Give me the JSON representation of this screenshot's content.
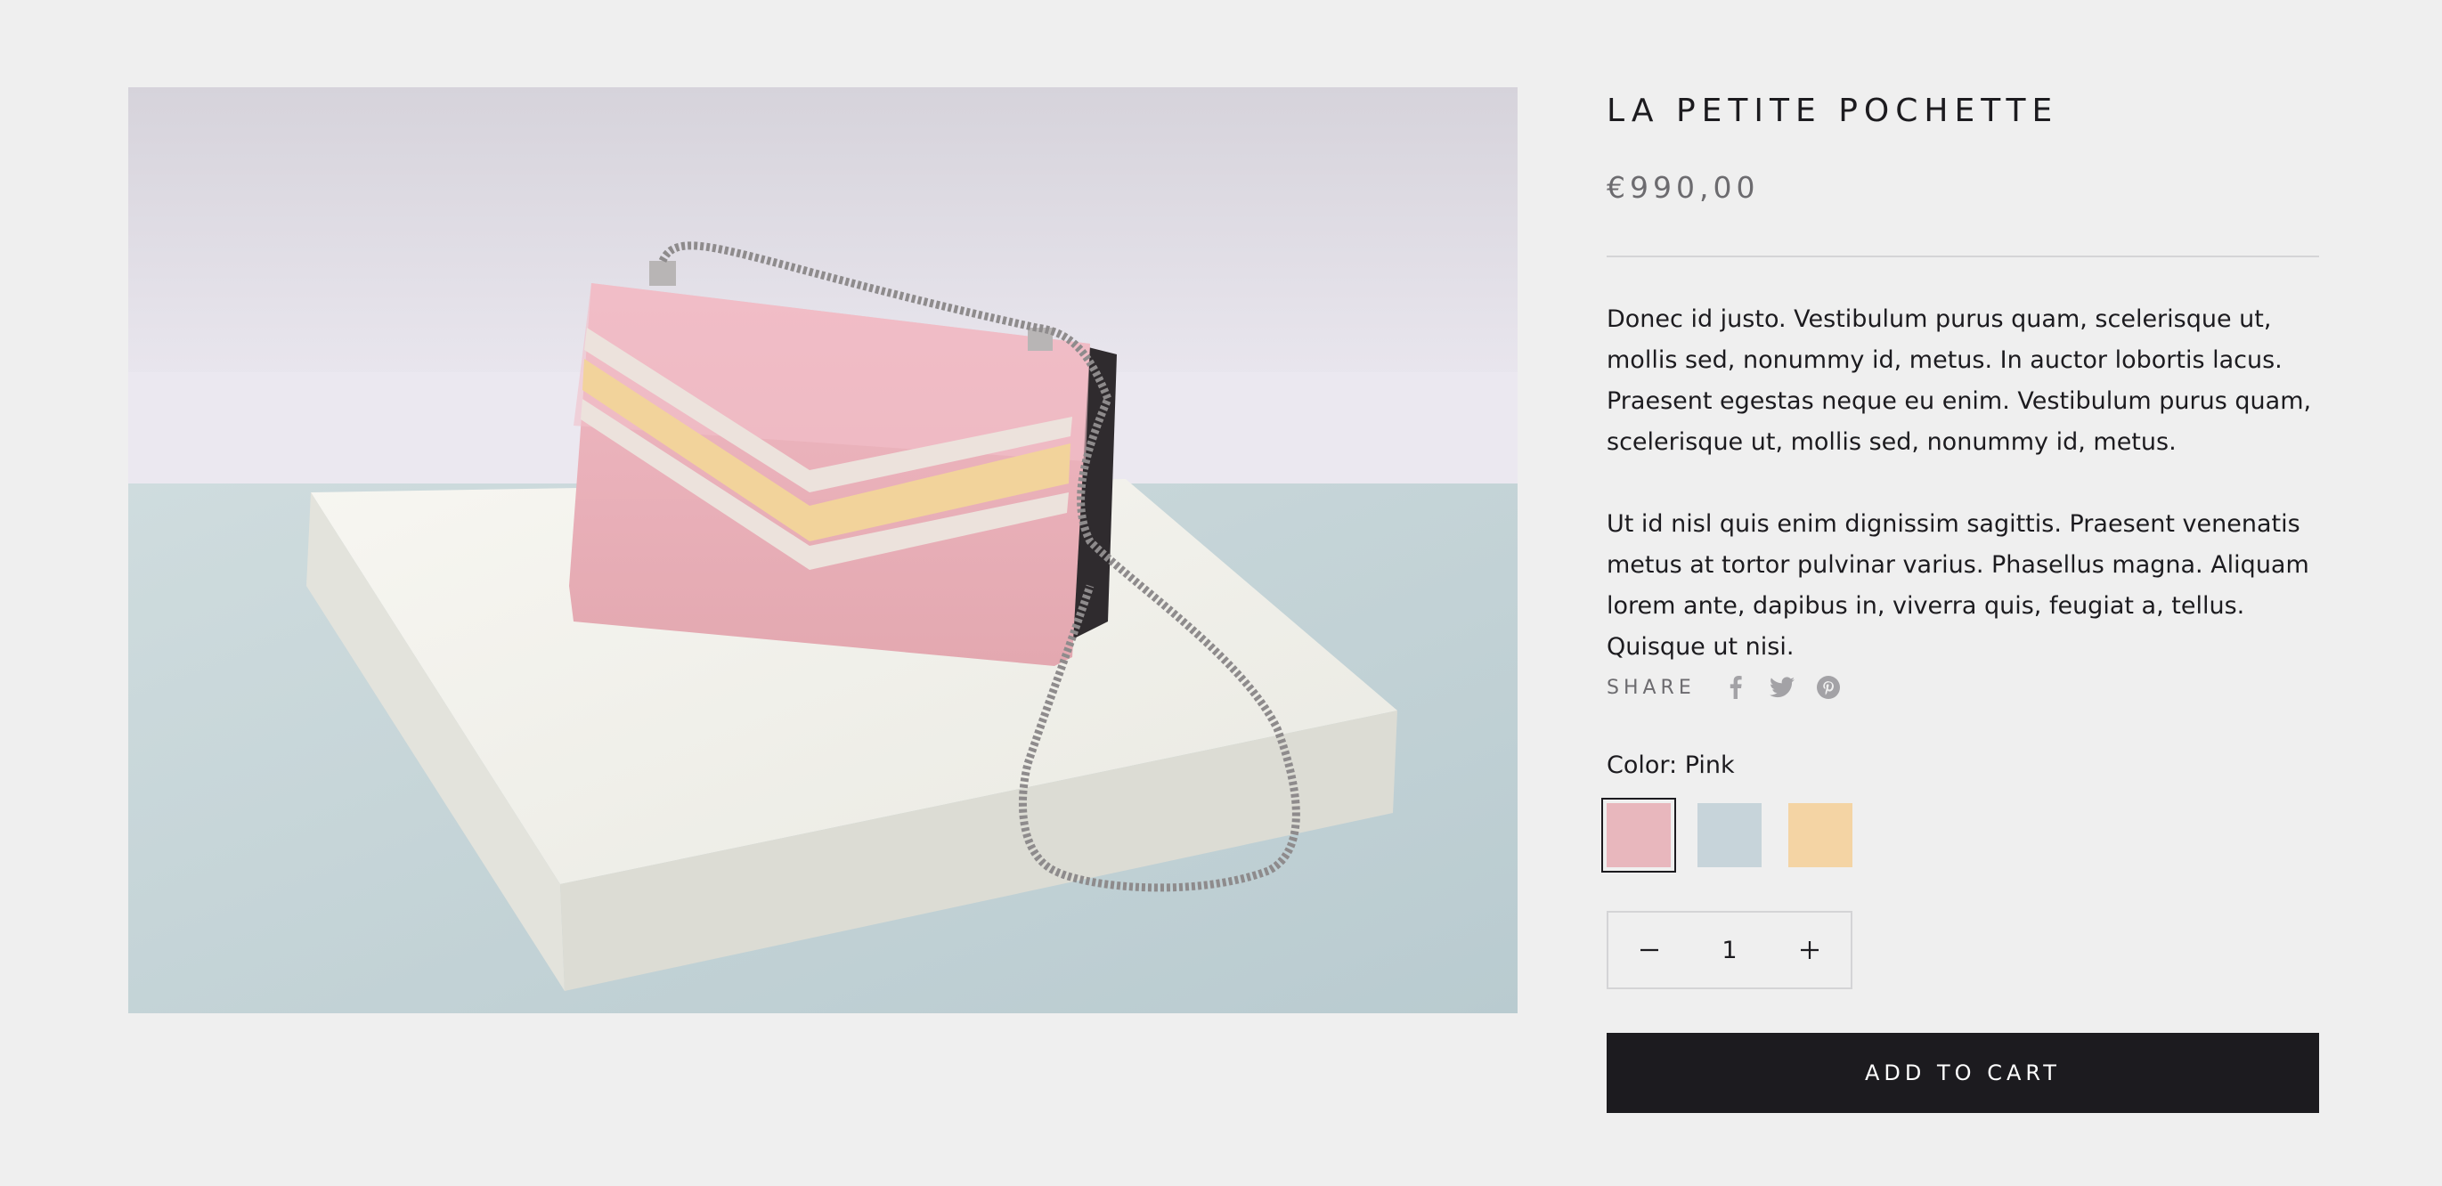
{
  "product": {
    "title": "LA PETITE POCHETTE",
    "price": "€990,00",
    "description": [
      "Donec id justo. Vestibulum purus quam, scelerisque ut, mollis sed, nonummy id, metus. In auctor lobortis lacus. Praesent egestas neque eu enim. Vestibulum purus quam, scelerisque ut, mollis sed, nonummy id, metus.",
      "Ut id nisl quis enim dignissim sagittis. Praesent venenatis metus at tortor pulvinar varius. Phasellus magna. Aliquam lorem ante, dapibus in, viverra quis, feugiat a, tellus. Quisque ut nisi."
    ],
    "image_icon": "pink-handbag-image"
  },
  "share": {
    "label": "SHARE",
    "icons": [
      "facebook-icon",
      "twitter-icon",
      "pinterest-icon"
    ]
  },
  "color": {
    "label": "Color: Pink",
    "swatches": [
      {
        "name": "Pink",
        "hex": "#e8b7bd",
        "selected": true
      },
      {
        "name": "Blue",
        "hex": "#c7d4da",
        "selected": false
      },
      {
        "name": "Yellow",
        "hex": "#f4d4a4",
        "selected": false
      }
    ]
  },
  "quantity": {
    "value": "1",
    "decrease_icon": "minus-icon",
    "increase_icon": "plus-icon"
  },
  "cart": {
    "button_label": "ADD TO CART"
  },
  "colors": {
    "background": "#efefef",
    "text": "#1c1b1f",
    "muted": "#6c6b6f",
    "button_bg": "#1c1b1f"
  }
}
